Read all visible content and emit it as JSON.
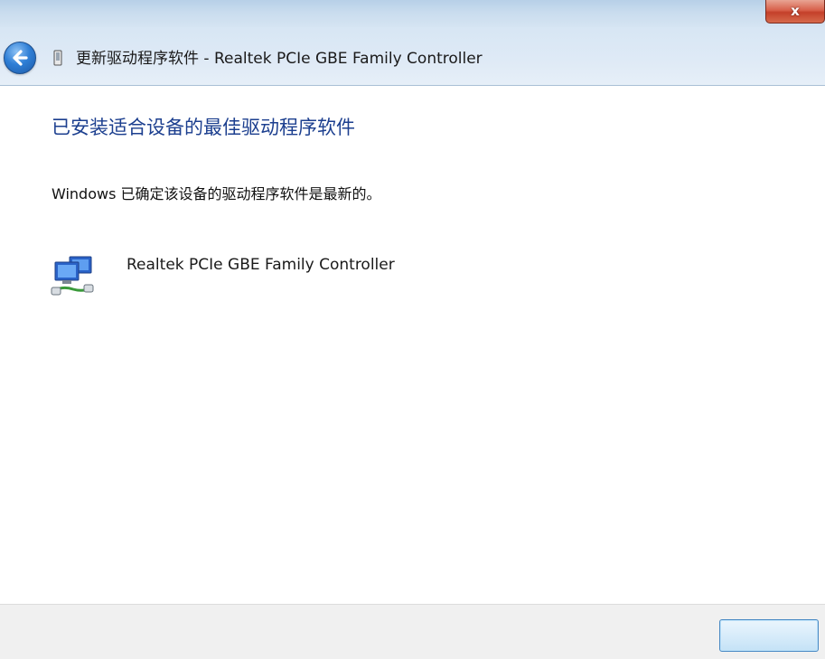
{
  "window": {
    "close_glyph": "x",
    "nav_title": "更新驱动程序软件 - Realtek PCIe GBE Family Controller"
  },
  "main": {
    "heading": "已安装适合设备的最佳驱动程序软件",
    "status": "Windows 已确定该设备的驱动程序软件是最新的。",
    "device": {
      "name": "Realtek PCIe GBE Family Controller",
      "icon": "network-adapter-icon"
    }
  },
  "footer": {
    "close_button_label": ""
  },
  "colors": {
    "heading": "#1c3f8f",
    "back_button": "#2f7fd6",
    "close_button": "#c4402a",
    "footer": "#f0f0f0"
  }
}
